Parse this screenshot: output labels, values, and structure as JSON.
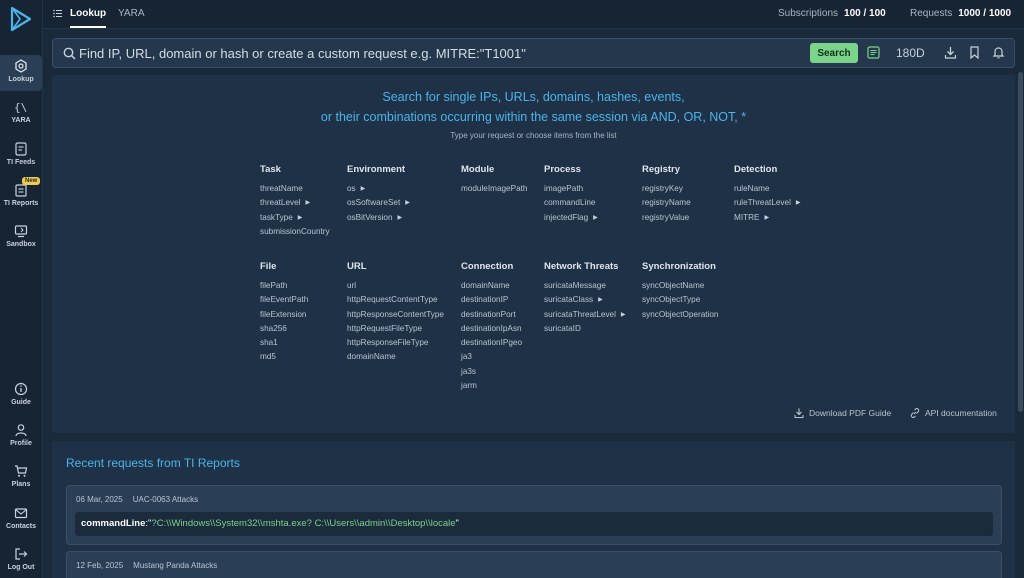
{
  "sidebar": {
    "logo_icon": "play-logo-icon",
    "items": [
      {
        "label": "Lookup",
        "icon": "lookup-icon"
      },
      {
        "label": "YARA",
        "icon": "braces-icon"
      },
      {
        "label": "TI Feeds",
        "icon": "feed-icon"
      },
      {
        "label": "TI Reports",
        "icon": "report-icon",
        "badge": "New"
      },
      {
        "label": "Sandbox",
        "icon": "sandbox-icon"
      }
    ],
    "bottom_items": [
      {
        "label": "Guide",
        "icon": "info-icon"
      },
      {
        "label": "Profile",
        "icon": "user-icon"
      },
      {
        "label": "Plans",
        "icon": "cart-icon"
      },
      {
        "label": "Contacts",
        "icon": "mail-icon"
      },
      {
        "label": "Log Out",
        "icon": "logout-icon"
      }
    ]
  },
  "topbar": {
    "tabs": [
      "Lookup",
      "YARA"
    ],
    "subscriptions_label": "Subscriptions",
    "subscriptions_value": "100 / 100",
    "requests_label": "Requests",
    "requests_value": "1000 / 1000"
  },
  "search": {
    "placeholder": "Find IP, URL, domain or hash or create a custom request e.g. MITRE:\"T1001\"",
    "button_label": "Search",
    "period": "180D"
  },
  "main": {
    "headline_1": "Search for single IPs, URLs, domains, hashes, events,",
    "headline_2": "or their combinations occurring within the same session via AND, OR, NOT, *",
    "subline": "Type your request or choose items from the list",
    "columns": [
      {
        "title": "Task",
        "items": [
          "threatName",
          "threatLevel",
          "taskType",
          "submissionCountry"
        ]
      },
      {
        "title": "Environment",
        "items": [
          "os",
          "osSoftwareSet",
          "osBitVersion"
        ]
      },
      {
        "title": "Module",
        "items": [
          "moduleImagePath"
        ]
      },
      {
        "title": "Process",
        "items": [
          "imagePath",
          "commandLine",
          "injectedFlag"
        ]
      },
      {
        "title": "Registry",
        "items": [
          "registryKey",
          "registryName",
          "registryValue"
        ]
      },
      {
        "title": "Detection",
        "items": [
          "ruleName",
          "ruleThreatLevel",
          "MITRE"
        ]
      },
      {
        "title": "File",
        "items": [
          "filePath",
          "fileEventPath",
          "fileExtension",
          "sha256",
          "sha1",
          "md5"
        ]
      },
      {
        "title": "URL",
        "items": [
          "url",
          "httpRequestContentType",
          "httpResponseContentType",
          "httpRequestFileType",
          "httpResponseFileType",
          "domainName"
        ]
      },
      {
        "title": "Connection",
        "items": [
          "domainName",
          "destinationIP",
          "destinationPort",
          "destinationIpAsn",
          "destinationIPgeo",
          "ja3",
          "ja3s",
          "jarm"
        ]
      },
      {
        "title": "Network Threats",
        "items": [
          "suricataMessage",
          "suricataClass",
          "suricataThreatLevel",
          "suricataID"
        ]
      },
      {
        "title": "Synchronization",
        "items": [
          "syncObjectName",
          "syncObjectType",
          "syncObjectOperation"
        ]
      }
    ],
    "download_pdf": "Download PDF Guide",
    "api_docs": "API documentation"
  },
  "recent": {
    "title": "Recent requests from TI Reports",
    "cards": [
      {
        "date": "06 Mar, 2025",
        "name": "UAC-0063 Attacks",
        "field": "commandLine",
        "value": "?C:\\\\Windows\\\\System32\\\\mshta.exe? C:\\\\Users\\\\admin\\\\Desktop\\\\locale"
      },
      {
        "date": "12 Feb, 2025",
        "name": "Mustang Panda Attacks"
      }
    ]
  },
  "colors": {
    "accent_blue": "#4cb4ea",
    "search_green": "#7ad489",
    "badge_yellow": "#f0c94d",
    "background": "#1b2a3a"
  }
}
